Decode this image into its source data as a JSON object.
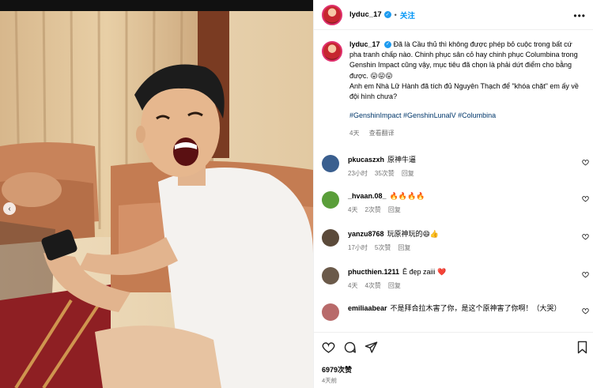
{
  "post": {
    "username": "lyduc_17",
    "dot": "•",
    "follow_label": "关注",
    "more_icon": "more-horizontal-icon",
    "caption": "Đã là Cầu thủ thì không được phép bỏ cuộc trong bất cứ pha tranh chấp nào. Chinh phục sân cỏ hay chinh phục Columbina trong Genshin Impact cũng vậy, mục tiêu đã chọn là phải dứt điểm cho bằng được. 😛😛😛",
    "caption_line2": "Anh em Nhà Lữ Hành đã tích đủ Nguyên Thạch để \"khóa chặt\" em ấy về đội hình chưa?",
    "hashtags": "#GenshinImpact #GenshinLunalV #Columbina",
    "age": "4天",
    "translation_label": "查看翻译"
  },
  "comments": [
    {
      "user": "pkucaszxh",
      "text": "原神牛逼",
      "age": "23小时",
      "likes": "35次赞",
      "reply": "回复",
      "avatar_color": "#3a5f8f"
    },
    {
      "user": "_hvaan.08_",
      "text": "🔥🔥🔥🔥",
      "age": "4天",
      "likes": "2次赞",
      "reply": "回复",
      "avatar_color": "#5a9e3a"
    },
    {
      "user": "yanzu8768",
      "text": "玩原神玩的😄👍",
      "age": "17小时",
      "likes": "5次赞",
      "reply": "回复",
      "avatar_color": "#5b4a3a"
    },
    {
      "user": "phucthien.1211",
      "text": "Ê đẹp zaiii ❤️",
      "age": "4天",
      "likes": "4次赞",
      "reply": "回复",
      "avatar_color": "#6b5a4a"
    },
    {
      "user": "emiliaabear",
      "text": "不是拜合拉木害了你，是这个原神害了你啊！（大哭）",
      "avatar_color": "#b86a6a"
    }
  ],
  "footer": {
    "likes": "6979次赞",
    "date": "4天前"
  },
  "colors": {
    "accent": "#0095f6",
    "verified": "#1d9bf0",
    "hashtag": "#00376b",
    "muted": "#737373"
  }
}
